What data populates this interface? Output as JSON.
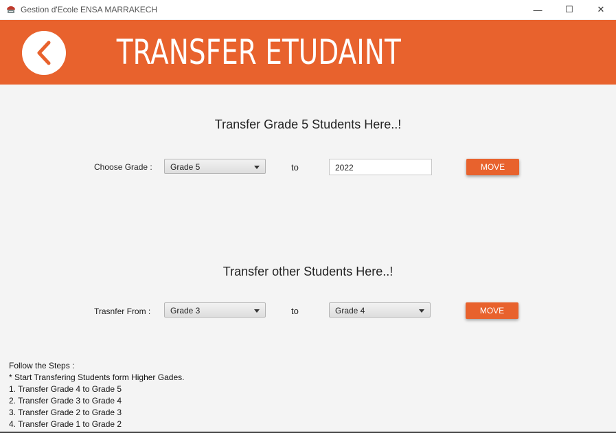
{
  "window": {
    "title": "Gestion d'Ecole ENSA MARRAKECH",
    "controls": {
      "minimize": "—",
      "maximize": "☐",
      "close": "✕"
    }
  },
  "banner": {
    "title": "TRANSFER ETUDAINT",
    "back_icon": "chevron-left-icon",
    "color": "#e8622d"
  },
  "section1": {
    "title": "Transfer Grade 5 Students Here..!",
    "label": "Choose Grade :",
    "select_value": "Grade 5",
    "to": "to",
    "input_value": "2022",
    "button": "MOVE"
  },
  "section2": {
    "title": "Transfer other Students Here..!",
    "label": "Trasnfer From :",
    "from_value": "Grade 3",
    "to": "to",
    "to_value": "Grade 4",
    "button": "MOVE"
  },
  "steps": [
    "Follow the Steps :",
    "* Start Transfering Students form Higher Gades.",
    "1. Transfer Grade 4 to Grade 5",
    "2. Transfer Grade 3 to Grade 4",
    "3. Transfer Grade 2 to Grade 3",
    "4. Transfer Grade 1 to Grade 2"
  ]
}
